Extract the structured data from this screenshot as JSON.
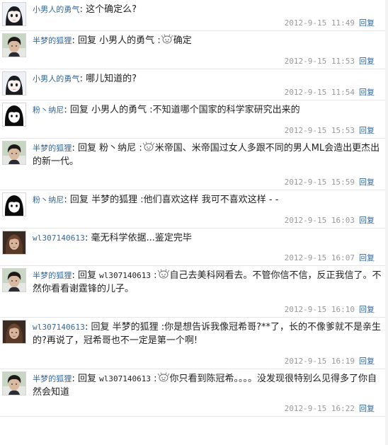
{
  "reply_label": "回复",
  "reply_word": "回复",
  "comments": [
    {
      "avatar": "avatar-girl-bangs",
      "name": "小男人的勇气",
      "name_mono": false,
      "reply_to": "",
      "emoticon": false,
      "text": "这个确定么?",
      "time": "2012-9-15 11:49"
    },
    {
      "avatar": "avatar-dark-hair-man",
      "name": "半梦的狐狸",
      "name_mono": false,
      "reply_to": "小男人的勇气",
      "emoticon": true,
      "text": "确定",
      "time": "2012-9-15 11:53"
    },
    {
      "avatar": "avatar-girl-bangs",
      "name": "小男人的勇气",
      "name_mono": false,
      "reply_to": "",
      "emoticon": false,
      "text": "哪儿知道的?",
      "time": "2012-9-15 11:54"
    },
    {
      "avatar": "avatar-black-hair-girl",
      "name": "粉丶纳尼",
      "name_mono": false,
      "reply_to": "小男人的勇气",
      "emoticon": false,
      "text": "不知道哪个国家的科学家研究出来的",
      "time": "2012-9-15 15:53"
    },
    {
      "avatar": "avatar-dark-hair-man",
      "name": "半梦的狐狸",
      "name_mono": false,
      "reply_to": "粉丶纳尼",
      "emoticon": true,
      "text": "米帝国、米帝国过女人多跟不同的男人ML会造出更杰出的新一代。",
      "time": "2012-9-15 15:59"
    },
    {
      "avatar": "avatar-black-hair-girl",
      "name": "粉丶纳尼",
      "name_mono": false,
      "reply_to": "半梦的狐狸",
      "emoticon": false,
      "text": "他们喜欢这样 我可不喜欢这样 - -",
      "time": "2012-9-15 16:03"
    },
    {
      "avatar": "avatar-brown-hair-woman",
      "name": "wl307140613",
      "name_mono": true,
      "reply_to": "",
      "emoticon": false,
      "text": "毫无科学依据...鉴定完毕",
      "time": "2012-9-15 16:07"
    },
    {
      "avatar": "avatar-dark-hair-man",
      "name": "半梦的狐狸",
      "name_mono": false,
      "reply_to": "wl307140613",
      "emoticon": true,
      "text": "自己去美科网看去。不管你信不信，反正我信了。不然你看看谢霆锋的儿子。",
      "time": "2012-9-15 16:10"
    },
    {
      "avatar": "avatar-brown-hair-woman",
      "name": "wl307140613",
      "name_mono": true,
      "reply_to": "半梦的狐狸",
      "emoticon": false,
      "text": "你是想告诉我像冠希哥?**了，长的不像爹就不是亲生的?再说了，冠希哥也不一定是第一个啊!",
      "time": "2012-9-15 16:19"
    },
    {
      "avatar": "avatar-dark-hair-man",
      "name": "半梦的狐狸",
      "name_mono": false,
      "reply_to": "wl307140613",
      "emoticon": true,
      "text": "你只看到陈冠希。。。。没发现很特别么见得多了你自然会知道",
      "time": "2012-9-15 16:22"
    }
  ]
}
